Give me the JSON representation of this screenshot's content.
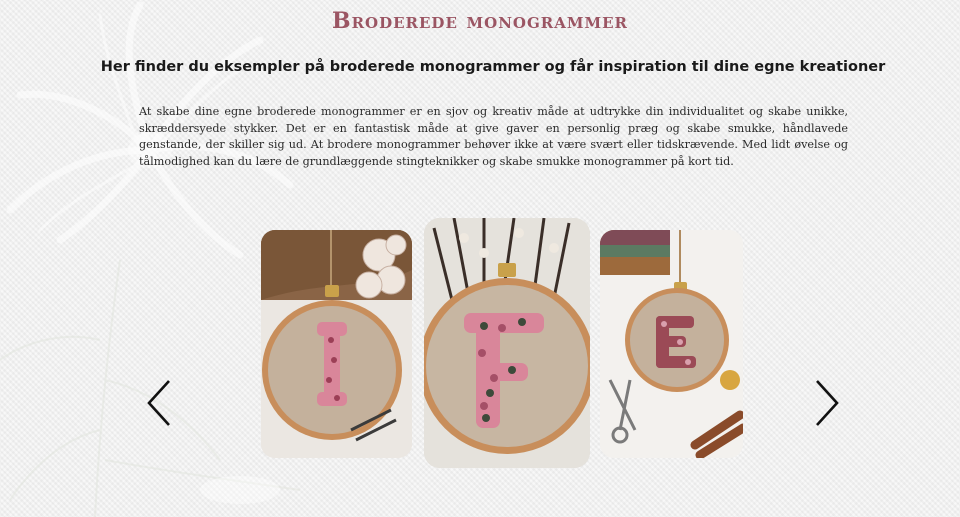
{
  "header": {
    "title": "Broderede monogrammer",
    "subtitle": "Her finder du eksempler på broderede monogrammer og får inspiration til dine egne kreationer"
  },
  "intro": {
    "text": "At skabe dine egne broderede monogrammer er en sjov og kreativ måde at udtrykke din individualitet og skabe unikke, skræddersyede stykker. Det er en fantastisk måde at give gaver en personlig præg og skabe smukke, håndlavede genstande, der skiller sig ud. At brodere monogrammer behøver ikke at være svært eller tidskrævende. Med lidt øvelse og tålmodighed kan du lære de grundlæggende stingteknikker og skabe smukke monogrammer på kort tid."
  },
  "carousel": {
    "slides": [
      {
        "letter": "I"
      },
      {
        "letter": "F"
      },
      {
        "letter": "E"
      }
    ],
    "prev_icon": "chevron-left-icon",
    "next_icon": "chevron-right-icon"
  },
  "colors": {
    "title": "#9b5563",
    "hoop_wood": "#c99565",
    "linen": "#c4b19c",
    "flower_pink": "#d9869a"
  }
}
